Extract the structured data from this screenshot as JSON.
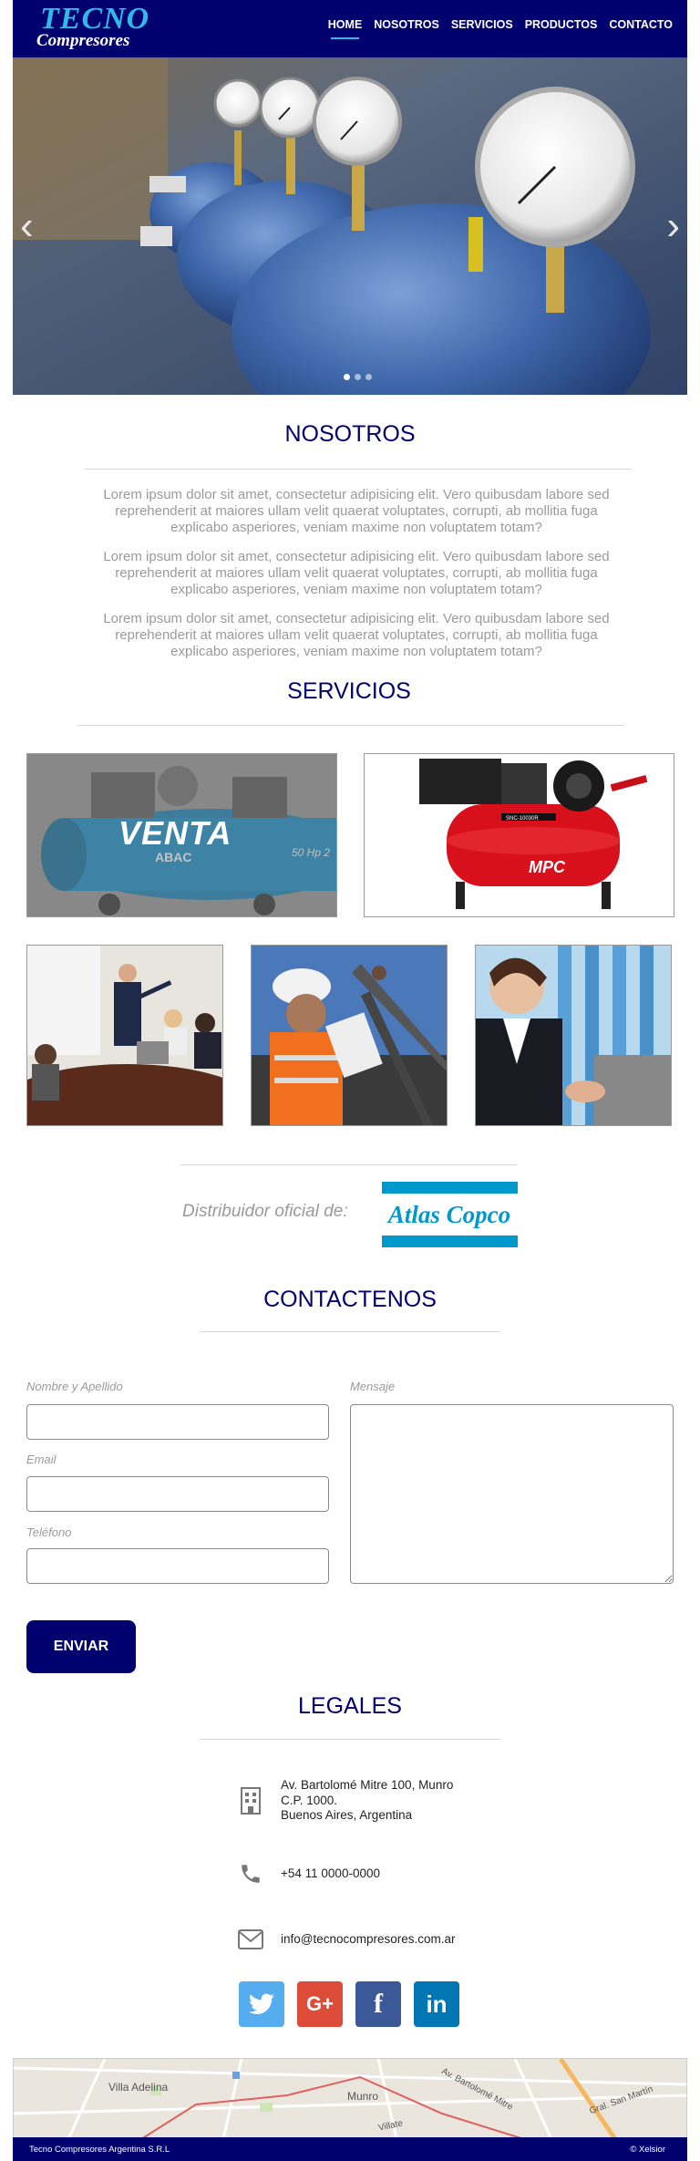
{
  "header": {
    "logo_top": "TECNO",
    "logo_bottom": "Compresores",
    "nav": [
      "HOME",
      "NOSOTROS",
      "SERVICIOS",
      "PRODUCTOS",
      "CONTACTO"
    ],
    "active_nav": "HOME"
  },
  "slider": {
    "prev_icon": "chevron-left-icon",
    "next_icon": "chevron-right-icon",
    "slide_count": 3,
    "active_slide": 1
  },
  "nosotros": {
    "title": "NOSOTROS",
    "paragraphs": [
      "Lorem ipsum dolor sit amet, consectetur adipisicing elit. Vero quibusdam labore sed reprehenderit at maiores ullam velit quaerat voluptates, corrupti, ab mollitia fuga explicabo asperiores, veniam maxime non voluptatem totam?",
      "Lorem ipsum dolor sit amet, consectetur adipisicing elit. Vero quibusdam labore sed reprehenderit at maiores ullam velit quaerat voluptates, corrupti, ab mollitia fuga explicabo asperiores, veniam maxime non voluptatem totam?",
      "Lorem ipsum dolor sit amet, consectetur adipisicing elit. Vero quibusdam labore sed reprehenderit at maiores ullam velit quaerat voluptates, corrupti, ab mollitia fuga explicabo asperiores, veniam maxime non voluptatem totam?"
    ]
  },
  "servicios": {
    "title": "SERVICIOS",
    "venta_label": "VENTA",
    "abac_label": "ABAC",
    "abac_spec": "50 Hp 2",
    "mpc_label": "MPC",
    "mpc_model": "SNC-10030R"
  },
  "distribuidor": {
    "label": "Distribuidor oficial de:",
    "brand": "Atlas Copco"
  },
  "contacto": {
    "title": "CONTACTENOS",
    "name_label": "Nombre y Apellido",
    "email_label": "Email",
    "phone_label": "Teléfono",
    "message_label": "Mensaje",
    "submit_label": "ENVIAR"
  },
  "legales": {
    "title": "LEGALES",
    "address_line1": "Av. Bartolomé Mitre 100, Munro",
    "address_line2": "C.P. 1000.",
    "address_line3": "Buenos Aires, Argentina",
    "phone": "+54 11 0000-0000",
    "email": "info@tecnocompresores.com.ar"
  },
  "socials": [
    {
      "name": "twitter",
      "glyph": "🐦",
      "color": "#55acee"
    },
    {
      "name": "google-plus",
      "glyph": "G+",
      "color": "#dd4b39"
    },
    {
      "name": "facebook",
      "glyph": "f",
      "color": "#3b5998"
    },
    {
      "name": "linkedin",
      "glyph": "in",
      "color": "#0077b5"
    }
  ],
  "map": {
    "labels": [
      "Villa Adelina",
      "Munro",
      "Av. Bartolomé Mitre",
      "Gral. San Martín",
      "Villate"
    ]
  },
  "footer": {
    "left": "Tecno Compresores Argentina S.R.L",
    "right": "© Xelsior"
  },
  "colors": {
    "brand_navy": "#00006e",
    "accent_cyan": "#2fb8e8",
    "atlas_blue": "#0099cc"
  }
}
